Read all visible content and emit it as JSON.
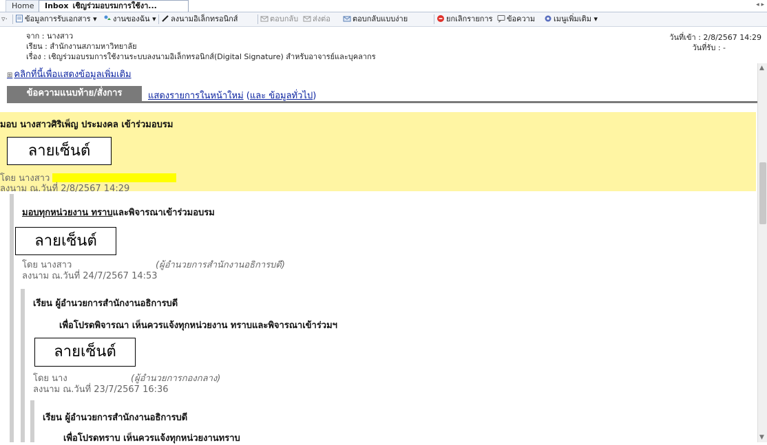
{
  "tabs": {
    "home": "Home",
    "inbox_prefix": "Inbox",
    "inbox_title": "เชิญร่วมอบรมการใช้งา..."
  },
  "toolbar": {
    "items": [
      "ข้อมูลการรับเอกสาร",
      "งานของฉัน",
      "ลงนามอิเล็กทรอนิกส์",
      "ตอบกลับ",
      "ส่งต่อ",
      "ตอบกลับแบบง่าย",
      "ยกเลิกรายการ",
      "ข้อความ",
      "เมนูเพิ่มเติม"
    ]
  },
  "header": {
    "from": "จาก : นางสาว",
    "to": "เรียน : สำนักงานสภามหาวิทยาลัย",
    "subject": "เรื่อง : เชิญร่วมอบรมการใช้งานระบบลงนามอิเล็กทรอนิกส์(Digital Signature) สำหรับอาจารย์และบุคลากร",
    "received_date": "วันที่เข้า : 2/8/2567 14:29",
    "accepted_date": "วันที่รับ : -"
  },
  "more_info_link": "คลิกที่นี้เพื่อแสดงข้อมูลเพิ่มเติม",
  "section": {
    "tab_label": "ข้อความแนบท้าย/สั่งการ",
    "link_new_page": "แสดงรายการในหน้าใหม่",
    "link_general_open": "(",
    "link_general": "และ ข้อมูลทั่วไป",
    "link_general_close": ")"
  },
  "entries": [
    {
      "instruction": "มอบ นางสาวศิริเพ็ญ ประมงคล เข้าร่วมอบรม",
      "signature": "ลายเซ็นต์",
      "by": "โดย นางสาว",
      "signed": "ลงนาม ณ.วันที่ 2/8/2567 14:29"
    },
    {
      "instruction_u": "มอบทุกหน่วยงาน ทราบ",
      "instruction_rest": "และพิจารณาเข้าร่วมอบรม",
      "signature": "ลายเซ็นต์",
      "by": "โดย นางสาว",
      "position": "(ผู้อำนวยการสำนักงานอธิการบดี)",
      "signed": "ลงนาม ณ.วันที่ 24/7/2567 14:53"
    },
    {
      "to": "เรียน ผู้อำนวยการสำนักงานอธิการบดี",
      "body": "เพื่อโปรดพิจารณา เห็นควรแจ้งทุกหน่วยงาน ทราบและพิจารณาเข้าร่วมฯ",
      "signature": "ลายเซ็นต์",
      "by": "โดย นาง",
      "position": "(ผู้อำนวยการกองกลาง)",
      "signed": "ลงนาม ณ.วันที่ 23/7/2567 16:36"
    },
    {
      "to": "เรียน ผู้อำนวยการสำนักงานอธิการบดี",
      "body": "เพื่อโปรดทราบ เห็นควรแจ้งทุกหน่วยงานทราบ"
    }
  ],
  "colors": {
    "highlight_block": "#fff5a3",
    "name_highlight": "#ffff00",
    "link": "#0a22a0",
    "tab_bg": "#7a7a7a"
  }
}
